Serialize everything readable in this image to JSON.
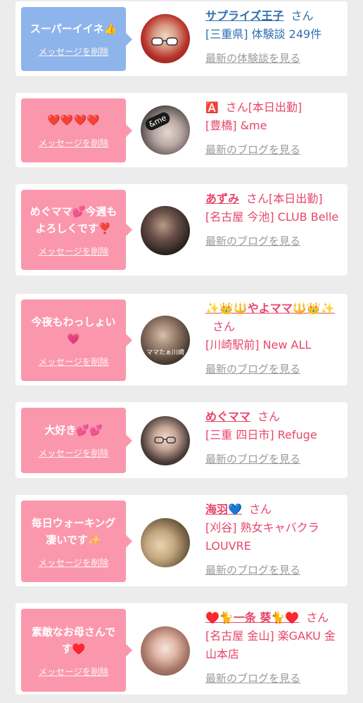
{
  "items": [
    {
      "message": "スーパーイイネ👍",
      "delete_label": "メッセージを削除",
      "user_name": "サプライズ王子",
      "user_suffix": "さん",
      "shop_info": "[三重県] 体験談 249件",
      "link_label": "最新の体験談を見る",
      "bubble_color": "#8eb4ec",
      "text_color": "#2e6fb0"
    },
    {
      "message": "❤️❤️❤️❤️",
      "delete_label": "メッセージを削除",
      "user_name": "🅰️",
      "user_suffix": "さん[本日出勤]",
      "shop_info": "[豊橋] &me",
      "link_label": "最新のブログを見る",
      "bubble_color": "#fb97ac",
      "text_color": "#e8456b"
    },
    {
      "message": "めぐママ💕今週もよろしくです❣️",
      "delete_label": "メッセージを削除",
      "user_name": "あずみ",
      "user_suffix": "さん[本日出勤]",
      "shop_info": "[名古屋 今池] CLUB Belle",
      "link_label": "最新のブログを見る",
      "bubble_color": "#fb97ac",
      "text_color": "#e8456b"
    },
    {
      "message": "今夜もわっしょい💗",
      "delete_label": "メッセージを削除",
      "user_name": "✨👑🔱やよママ🔱👑✨",
      "user_suffix": "さん",
      "shop_info": "[川崎駅前] New ALL",
      "link_label": "最新のブログを見る",
      "bubble_color": "#fb97ac",
      "text_color": "#e8456b"
    },
    {
      "message": "大好き💕💕",
      "delete_label": "メッセージを削除",
      "user_name": "めぐママ",
      "user_suffix": "さん",
      "shop_info": "[三重 四日市] Refuge",
      "link_label": "最新のブログを見る",
      "bubble_color": "#fb97ac",
      "text_color": "#e8456b"
    },
    {
      "message": "毎日ウォーキング凄いです✨",
      "delete_label": "メッセージを削除",
      "user_name": "海羽💙",
      "user_suffix": "さん",
      "shop_info": "[刈谷] 熟女キャバクラ LOUVRE",
      "link_label": "最新のブログを見る",
      "bubble_color": "#fb97ac",
      "text_color": "#e8456b"
    },
    {
      "message": "素敵なお母さんです♥️",
      "delete_label": "メッセージを削除",
      "user_name": "♥️🐈一条 葵🐈♥️",
      "user_suffix": "さん",
      "shop_info": "[名古屋 金山] 楽GAKU 金山本店",
      "link_label": "最新のブログを見る",
      "bubble_color": "#fb97ac",
      "text_color": "#e8456b"
    }
  ],
  "avatar_overlay_texts": {
    "item2": "&me",
    "item4": "ママたぁ川崎"
  }
}
